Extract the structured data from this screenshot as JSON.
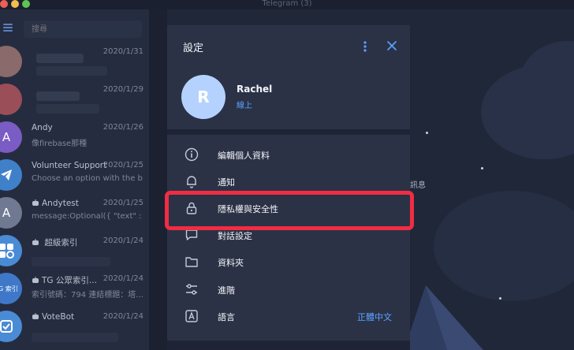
{
  "window": {
    "title": "Telegram (3)"
  },
  "sidebar": {
    "search_placeholder": "搜尋",
    "chats": [
      {
        "name": "",
        "date": "2020/1/31",
        "preview": "",
        "avatar_letter": "",
        "avatar_color": "#8a6a6a"
      },
      {
        "name": "",
        "date": "2020/1/29",
        "preview": "",
        "avatar_letter": "",
        "avatar_color": "#9a4e58"
      },
      {
        "name": "Andy",
        "date": "2020/1/26",
        "preview": "像firebase那種",
        "avatar_letter": "A",
        "avatar_color": "#7b5bc4"
      },
      {
        "name": "Volunteer Support",
        "date": "2020/1/25",
        "preview": "Choose an option with the b...",
        "avatar_letter": "",
        "avatar_color": "#3f80c9"
      },
      {
        "name": "Andytest",
        "date": "2020/1/25",
        "preview": "message:Optional({ \"text\" : ...",
        "avatar_letter": "A",
        "avatar_color": "#6f7a92"
      },
      {
        "name": "超級索引",
        "date": "2020/1/24",
        "preview": "",
        "avatar_letter": "",
        "avatar_color": "#4a8bd6"
      },
      {
        "name": "TG 公眾索引...",
        "date": "2020/1/24",
        "preview": "索引號碼：794 連結標題：塔...",
        "avatar_letter": "TG 索引",
        "avatar_color": "#3f78c8"
      },
      {
        "name": "VoteBot",
        "date": "2020/1/24",
        "preview": "",
        "avatar_letter": "",
        "avatar_color": "#4a8bd6"
      }
    ]
  },
  "background": {
    "hint_text": "訊息"
  },
  "settings": {
    "title": "設定",
    "profile": {
      "initial": "R",
      "name": "Rachel",
      "status": "線上"
    },
    "items": [
      {
        "icon": "info-icon",
        "label": "編輯個人資料",
        "value": ""
      },
      {
        "icon": "bell-icon",
        "label": "通知",
        "value": ""
      },
      {
        "icon": "lock-icon",
        "label": "隱私權與安全性",
        "value": ""
      },
      {
        "icon": "chat-bubble-icon",
        "label": "對話設定",
        "value": ""
      },
      {
        "icon": "folder-icon",
        "label": "資料夾",
        "value": ""
      },
      {
        "icon": "sliders-icon",
        "label": "進階",
        "value": ""
      },
      {
        "icon": "language-icon",
        "label": "語言",
        "value": "正體中文"
      }
    ]
  },
  "colors": {
    "accent": "#5ca3ff",
    "highlight": "#f12c43",
    "modal_bg": "#2b3246"
  }
}
